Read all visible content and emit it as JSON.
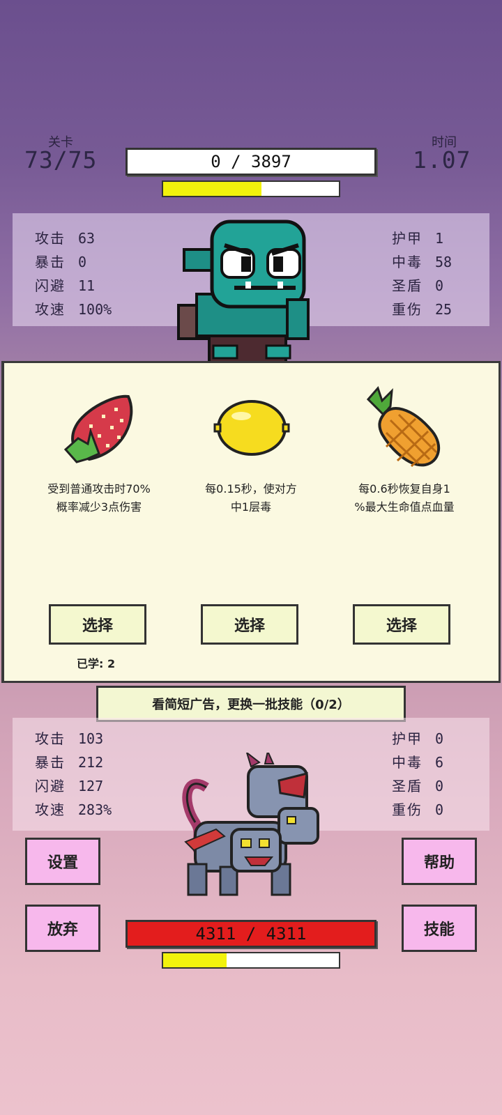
{
  "hud": {
    "stage_label": "关卡",
    "stage_value": "73/75",
    "time_label": "时间",
    "time_value": "1.07",
    "enemy_hp_text": "0  /  3897",
    "enemy_progress": 0.56
  },
  "enemy_stats": {
    "left": [
      {
        "label": "攻击",
        "value": "63"
      },
      {
        "label": "暴击",
        "value": "0"
      },
      {
        "label": "闪避",
        "value": "11"
      },
      {
        "label": "攻速",
        "value": "100%"
      }
    ],
    "right": [
      {
        "label": "护甲",
        "value": "1"
      },
      {
        "label": "中毒",
        "value": "58"
      },
      {
        "label": "圣盾",
        "value": "0"
      },
      {
        "label": "重伤",
        "value": "25"
      }
    ]
  },
  "skills": [
    {
      "icon": "strawberry-icon",
      "desc_line1": "受到普通攻击时70%",
      "desc_line2": "概率减少3点伤害",
      "button": "选择"
    },
    {
      "icon": "lemon-icon",
      "desc_line1": "每0.15秒，使对方",
      "desc_line2": "中1层毒",
      "button": "选择"
    },
    {
      "icon": "pineapple-icon",
      "desc_line1": "每0.6秒恢复自身1",
      "desc_line2": "%最大生命值点血量",
      "button": "选择"
    }
  ],
  "learned_text": "已学: 2",
  "ad_button": "看简短广告，更换一批技能（0/2）",
  "player_stats": {
    "left": [
      {
        "label": "攻击",
        "value": "103"
      },
      {
        "label": "暴击",
        "value": "212"
      },
      {
        "label": "闪避",
        "value": "127"
      },
      {
        "label": "攻速",
        "value": "283%"
      }
    ],
    "right": [
      {
        "label": "护甲",
        "value": "0"
      },
      {
        "label": "中毒",
        "value": "6"
      },
      {
        "label": "圣盾",
        "value": "0"
      },
      {
        "label": "重伤",
        "value": "0"
      }
    ]
  },
  "buttons": {
    "settings": "设置",
    "help": "帮助",
    "give_up": "放弃",
    "skills": "技能"
  },
  "player_hp_text": "4311  /  4311",
  "player_progress": 0.36,
  "colors": {
    "hp_red": "#e31d1d",
    "progress_yellow": "#f2f20c",
    "pink_button": "#f7b8ec",
    "card_bg": "#fbf9e1"
  }
}
